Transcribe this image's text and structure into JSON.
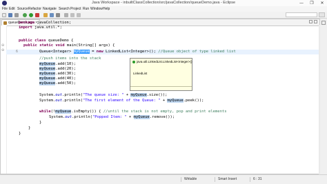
{
  "window": {
    "title": "Java Workspace - inbuiltClassCollection/src/javaCollection/queueDemo.java - Eclipse",
    "minimize": "—",
    "maximize": "❐",
    "close": "✕"
  },
  "menu": [
    "File",
    "Edit",
    "Source",
    "Refactor",
    "Navigate",
    "Search",
    "Project",
    "Run",
    "Window",
    "Help"
  ],
  "editor": {
    "tab_label": "queueDemo.java",
    "tab_close": "✕"
  },
  "code": {
    "l1_kw": "package",
    "l1_rest": " javaCollection;",
    "l2_kw": "import",
    "l2_rest": " java.util.*;",
    "l4_kw1": "public",
    "l4_kw2": "class",
    "l4_rest": " queueDemo {",
    "l5_kw1": "public",
    "l5_kw2": "static",
    "l5_kw3": "void",
    "l5_rest": " main(String[] args) {",
    "l6_a": "Queue<Integer> ",
    "l6_var": "myQueue",
    "l6_b": " = ",
    "l6_kw": "new",
    "l6_c": " LinkedList<Integer>();",
    "l6_cm": " //Queue object of type linked list",
    "l7_cm": "//push items into the stack",
    "l8_var": "myQueue",
    "l8_rest": ".add(10);",
    "l9_var": "myQueue",
    "l9_rest": ".add(20);",
    "l10_var": "myQueue",
    "l10_rest": ".add(30);",
    "l11_var": "myQueue",
    "l11_rest": ".add(40);",
    "l12_var": "myQueue",
    "l12_rest": ".add(50);",
    "l14_a": "System.",
    "l14_out": "out",
    "l14_b": ".println(",
    "l14_str": "\"The queue size: \"",
    "l14_c": " + ",
    "l14_var": "myQueue",
    "l14_d": ".size());",
    "l15_a": "System.",
    "l15_out": "out",
    "l15_b": ".println(",
    "l15_str": "\"The first element of the Queue: \"",
    "l15_c": " + ",
    "l15_var": "myQueue",
    "l15_d": ".peek());",
    "l17_kw": "while",
    "l17_a": "(!",
    "l17_var": "myQueue",
    "l17_b": ".isEmpty()) {",
    "l17_cm": " //until the stack is not empty, pop and print elements",
    "l18_a": "System.",
    "l18_out": "out",
    "l18_b": ".println(",
    "l18_str": "\"Popped Item: \"",
    "l18_c": " + ",
    "l18_var": "myQueue",
    "l18_d": ".remove());",
    "l19": "}",
    "l20": "}",
    "l21": "}"
  },
  "line_numbers": {
    "ln6": "6"
  },
  "popup": {
    "header": "java.util.LinkedList.LinkedList<Integer>()",
    "sub": "LinkedList"
  },
  "status": {
    "writable": "Writable",
    "insert_mode": "Smart Insert",
    "position": "6 : 31"
  },
  "colors": {
    "keyword": "#7f0055",
    "string": "#2a00ff",
    "comment": "#3f7f5f"
  },
  "icons": [
    "eclipse-logo-icon",
    "new-file-icon",
    "save-icon",
    "debug-icon",
    "run-icon",
    "search-icon",
    "java-file-icon",
    "perspective-icon"
  ]
}
